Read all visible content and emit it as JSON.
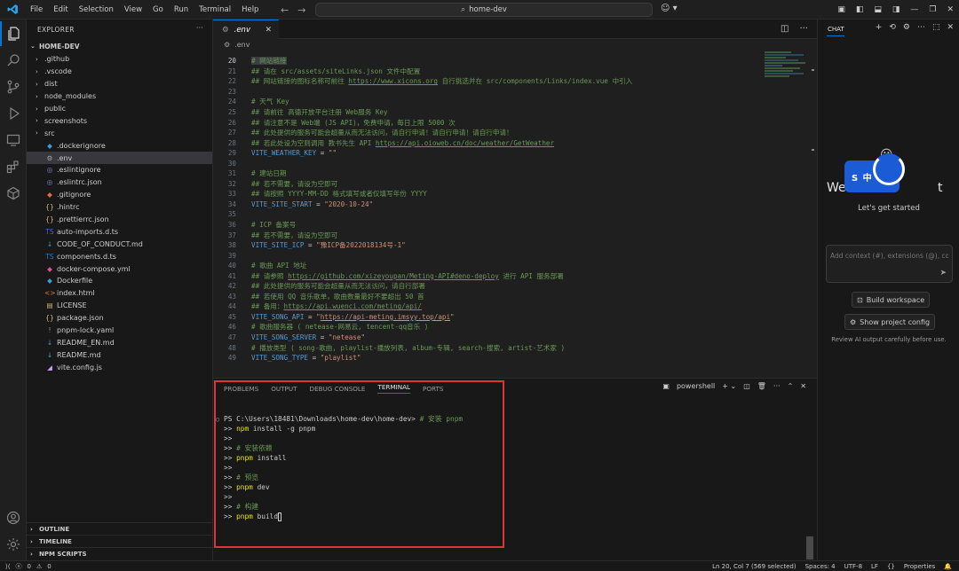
{
  "menu": [
    "File",
    "Edit",
    "Selection",
    "View",
    "Go",
    "Run",
    "Terminal",
    "Help"
  ],
  "command_center": "home-dev",
  "explorer": {
    "title": "EXPLORER",
    "root": "HOME-DEV",
    "items": [
      {
        "name": ".github",
        "type": "folder",
        "icon": ""
      },
      {
        "name": ".vscode",
        "type": "folder",
        "icon": ""
      },
      {
        "name": "dist",
        "type": "folder",
        "icon": ""
      },
      {
        "name": "node_modules",
        "type": "folder",
        "icon": ""
      },
      {
        "name": "public",
        "type": "folder",
        "icon": ""
      },
      {
        "name": "screenshots",
        "type": "folder",
        "icon": ""
      },
      {
        "name": "src",
        "type": "folder",
        "icon": ""
      },
      {
        "name": ".dockerignore",
        "type": "file",
        "icon": "◆",
        "color": "#3e9bd6"
      },
      {
        "name": ".env",
        "type": "file",
        "icon": "⚙",
        "color": "#aaaaaa",
        "selected": true
      },
      {
        "name": ".eslintignore",
        "type": "file",
        "icon": "◎",
        "color": "#8f8fd8"
      },
      {
        "name": ".eslintrc.json",
        "type": "file",
        "icon": "◎",
        "color": "#8f8fd8"
      },
      {
        "name": ".gitignore",
        "type": "file",
        "icon": "◆",
        "color": "#e06c40"
      },
      {
        "name": ".hintrc",
        "type": "file",
        "icon": "{}",
        "color": "#d7ba7d"
      },
      {
        "name": ".prettierrc.json",
        "type": "file",
        "icon": "{}",
        "color": "#d7ba7d"
      },
      {
        "name": "auto-imports.d.ts",
        "type": "file",
        "icon": "TS",
        "color": "#3178c6"
      },
      {
        "name": "CODE_OF_CONDUCT.md",
        "type": "file",
        "icon": "↓",
        "color": "#519aba"
      },
      {
        "name": "components.d.ts",
        "type": "file",
        "icon": "TS",
        "color": "#3178c6"
      },
      {
        "name": "docker-compose.yml",
        "type": "file",
        "icon": "◆",
        "color": "#e0508a"
      },
      {
        "name": "Dockerfile",
        "type": "file",
        "icon": "◆",
        "color": "#3e9bd6"
      },
      {
        "name": "index.html",
        "type": "file",
        "icon": "<>",
        "color": "#e37933"
      },
      {
        "name": "LICENSE",
        "type": "file",
        "icon": "▤",
        "color": "#d7ba7d"
      },
      {
        "name": "package.json",
        "type": "file",
        "icon": "{}",
        "color": "#d7ba7d"
      },
      {
        "name": "pnpm-lock.yaml",
        "type": "file",
        "icon": "!",
        "color": "#a074c4"
      },
      {
        "name": "README_EN.md",
        "type": "file",
        "icon": "↓",
        "color": "#519aba"
      },
      {
        "name": "README.md",
        "type": "file",
        "icon": "↓",
        "color": "#519aba"
      },
      {
        "name": "vite.config.js",
        "type": "file",
        "icon": "◢",
        "color": "#c5a5ff"
      }
    ],
    "outline": "OUTLINE",
    "timeline": "TIMELINE",
    "npm_scripts": "NPM SCRIPTS"
  },
  "editor": {
    "tab": ".env",
    "breadcrumb": ".env",
    "lines": [
      {
        "n": "20",
        "parts": [
          [
            "cm",
            "# 网站链接"
          ]
        ],
        "current": true
      },
      {
        "n": "21",
        "parts": [
          [
            "cm",
            "## 请在 src/assets/siteLinks.json 文件中配置"
          ]
        ]
      },
      {
        "n": "22",
        "parts": [
          [
            "cm",
            "## 网站链接的图标名称可前往 "
          ],
          [
            "url",
            "https://www.xicons.org"
          ],
          [
            "cm",
            " 自行挑选并在 src/components/Links/index.vue 中引入"
          ]
        ]
      },
      {
        "n": "23",
        "parts": []
      },
      {
        "n": "24",
        "parts": [
          [
            "cm",
            "# 天气 Key"
          ]
        ]
      },
      {
        "n": "25",
        "parts": [
          [
            "cm",
            "## 请前往 高德开放平台注册 Web服务 Key"
          ]
        ]
      },
      {
        "n": "26",
        "parts": [
          [
            "cm",
            "## 请注意不是 Web端 (JS API)，免费申请，每日上限 5000 次"
          ]
        ]
      },
      {
        "n": "27",
        "parts": [
          [
            "cm",
            "## 此处提供的服务可能会超量从而无法访问，请自行申请！请自行申请！请自行申请！"
          ]
        ]
      },
      {
        "n": "28",
        "parts": [
          [
            "cm",
            "## 若此处设为空则调用 教书先生 API "
          ],
          [
            "url",
            "https://api.oioweb.cn/doc/weather/GetWeather"
          ]
        ]
      },
      {
        "n": "29",
        "parts": [
          [
            "kw",
            "VITE_WEATHER_KEY"
          ],
          [
            "op",
            " = "
          ],
          [
            "st",
            "\"\""
          ]
        ]
      },
      {
        "n": "30",
        "parts": []
      },
      {
        "n": "31",
        "parts": [
          [
            "cm",
            "# 建站日期"
          ]
        ]
      },
      {
        "n": "32",
        "parts": [
          [
            "cm",
            "## 若不需要，请设为空即可"
          ]
        ]
      },
      {
        "n": "33",
        "parts": [
          [
            "cm",
            "## 请按照 YYYY-MM-DD 格式填写或者仅填写年份 YYYY"
          ]
        ]
      },
      {
        "n": "34",
        "parts": [
          [
            "kw",
            "VITE_SITE_START"
          ],
          [
            "op",
            " = "
          ],
          [
            "st",
            "\"2020-10-24\""
          ]
        ]
      },
      {
        "n": "35",
        "parts": []
      },
      {
        "n": "36",
        "parts": [
          [
            "cm",
            "# ICP 备案号"
          ]
        ]
      },
      {
        "n": "37",
        "parts": [
          [
            "cm",
            "## 若不需要，请设为空即可"
          ]
        ]
      },
      {
        "n": "38",
        "parts": [
          [
            "kw",
            "VITE_SITE_ICP"
          ],
          [
            "op",
            " = "
          ],
          [
            "st",
            "\"豫ICP备2022018134号-1\""
          ]
        ]
      },
      {
        "n": "39",
        "parts": []
      },
      {
        "n": "40",
        "parts": [
          [
            "cm",
            "# 歌曲 API 地址"
          ]
        ]
      },
      {
        "n": "41",
        "parts": [
          [
            "cm",
            "## 请参照 "
          ],
          [
            "url",
            "https://github.com/xizeyoupan/Meting-API#deno-deploy"
          ],
          [
            "cm",
            " 进行 API 服务部署"
          ]
        ]
      },
      {
        "n": "42",
        "parts": [
          [
            "cm",
            "## 此处提供的服务可能会超量从而无法访问，请自行部署"
          ]
        ]
      },
      {
        "n": "43",
        "parts": [
          [
            "cm",
            "## 若使用 QQ 音乐歌单，歌曲数量最好不要超出 50 首"
          ]
        ]
      },
      {
        "n": "44",
        "parts": [
          [
            "cm",
            "## 备用："
          ],
          [
            "url",
            "https://api.wuenci.com/meting/api/"
          ]
        ]
      },
      {
        "n": "45",
        "parts": [
          [
            "kw",
            "VITE_SONG_API"
          ],
          [
            "op",
            " = "
          ],
          [
            "st",
            "\""
          ],
          [
            "urls",
            "https://api-meting.imsyy.top/api"
          ],
          [
            "st",
            "\""
          ]
        ]
      },
      {
        "n": "46",
        "parts": [
          [
            "cm",
            "# 歌曲服务器 ( netease-网易云, tencent-qq音乐 )"
          ]
        ]
      },
      {
        "n": "47",
        "parts": [
          [
            "kw",
            "VITE_SONG_SERVER"
          ],
          [
            "op",
            " = "
          ],
          [
            "st",
            "\"netease\""
          ]
        ]
      },
      {
        "n": "48",
        "parts": [
          [
            "cm",
            "# 播放类型 ( song-歌曲, playlist-播放列表, album-专辑, search-搜索, artist-艺术家 )"
          ]
        ]
      },
      {
        "n": "49",
        "parts": [
          [
            "kw",
            "VITE_SONG_TYPE"
          ],
          [
            "op",
            " = "
          ],
          [
            "st",
            "\"playlist\""
          ]
        ]
      }
    ]
  },
  "panel": {
    "tabs": [
      "PROBLEMS",
      "OUTPUT",
      "DEBUG CONSOLE",
      "TERMINAL",
      "PORTS"
    ],
    "active_tab": "TERMINAL",
    "shell": "powershell",
    "terminal": [
      {
        "parts": [
          [
            "p",
            "PS C:\\Users\\18481\\Downloads\\home-dev\\home-dev> "
          ],
          [
            "c",
            "# 安装 pnpm"
          ]
        ],
        "dot": true
      },
      {
        "parts": [
          [
            "p",
            ">> "
          ],
          [
            "y",
            "npm"
          ],
          [
            "p",
            " install -g pnpm"
          ]
        ]
      },
      {
        "parts": [
          [
            "p",
            ">>"
          ]
        ]
      },
      {
        "parts": [
          [
            "p",
            ">> "
          ],
          [
            "c",
            "# 安装依赖"
          ]
        ]
      },
      {
        "parts": [
          [
            "p",
            ">> "
          ],
          [
            "y",
            "pnpm"
          ],
          [
            "p",
            " install"
          ]
        ]
      },
      {
        "parts": [
          [
            "p",
            ">>"
          ]
        ]
      },
      {
        "parts": [
          [
            "p",
            ">> "
          ],
          [
            "c",
            "# 预览"
          ]
        ]
      },
      {
        "parts": [
          [
            "p",
            ">> "
          ],
          [
            "y",
            "pnpm"
          ],
          [
            "p",
            " dev"
          ]
        ]
      },
      {
        "parts": [
          [
            "p",
            ">>"
          ]
        ]
      },
      {
        "parts": [
          [
            "p",
            ">> "
          ],
          [
            "c",
            "# 构建"
          ]
        ]
      },
      {
        "parts": [
          [
            "p",
            ">> "
          ],
          [
            "y",
            "pnpm"
          ],
          [
            "p",
            " build"
          ]
        ],
        "cursor": true
      }
    ]
  },
  "chat": {
    "title": "CHAT",
    "welcome_prefix": "We",
    "welcome_suffix": "t",
    "subtitle": "Let's get started",
    "badge": "S 中 ☁",
    "input_placeholder": "Add context (#), extensions (@), commands",
    "build_workspace": "Build workspace",
    "show_config": "Show project config",
    "review": "Review AI output carefully before use."
  },
  "status": {
    "errors": "0",
    "warnings": "0",
    "position": "Ln 20, Col 7 (569 selected)",
    "spaces": "Spaces: 4",
    "encoding": "UTF-8",
    "eol": "LF",
    "language": "Properties"
  }
}
